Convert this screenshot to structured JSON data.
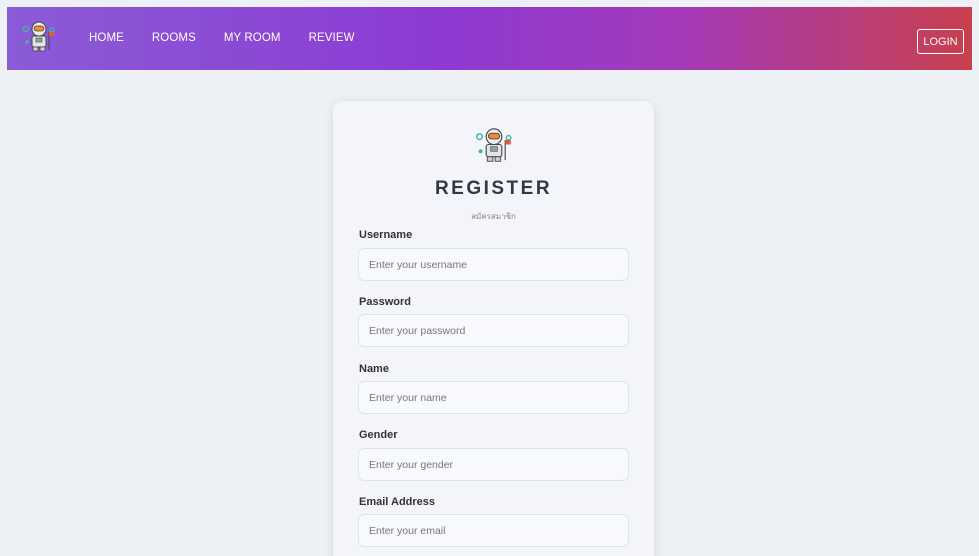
{
  "navbar": {
    "logo_icon": "astronaut-icon",
    "links": [
      "HOME",
      "ROOMS",
      "MY ROOM",
      "REVIEW"
    ],
    "login_label": "LOGIN",
    "gradient_colors": [
      "#8a5cd6",
      "#8d3ad3",
      "#a43ab8",
      "#c8404e"
    ]
  },
  "register": {
    "logo_icon": "astronaut-icon",
    "title": "REGISTER",
    "subtitle": "สมัครสมาชิก",
    "fields": [
      {
        "label": "Username",
        "placeholder": "Enter your username",
        "value": ""
      },
      {
        "label": "Password",
        "placeholder": "Enter your password",
        "value": ""
      },
      {
        "label": "Name",
        "placeholder": "Enter your name",
        "value": ""
      },
      {
        "label": "Gender",
        "placeholder": "Enter your gender",
        "value": ""
      },
      {
        "label": "Email Address",
        "placeholder": "Enter your email",
        "value": ""
      }
    ]
  }
}
